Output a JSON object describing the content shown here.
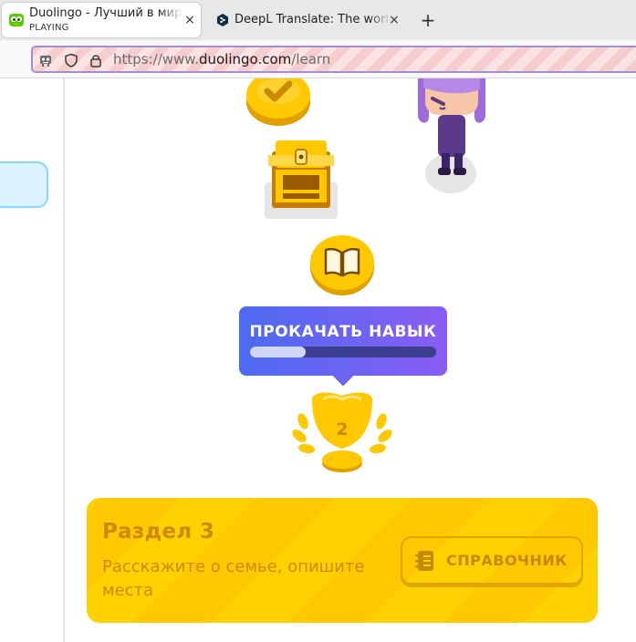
{
  "browser": {
    "tabs": [
      {
        "title": "Duolingo - Лучший в мире способ",
        "subtitle": "PLAYING",
        "active": true,
        "close_label": "×"
      },
      {
        "title": "DeepL Translate: The world",
        "active": false,
        "close_label": "×"
      }
    ],
    "new_tab_label": "+",
    "url": {
      "prefix": "https://www.",
      "host": "duolingo.com",
      "path": "/learn"
    }
  },
  "path": {
    "skill_tooltip": {
      "label": "ПРОКАЧАТЬ НАВЫК",
      "progress": 0.3
    },
    "trophy_level": "2"
  },
  "unit": {
    "title": "Раздел 3",
    "description": "Расскажите о семье, опишите места",
    "guide_label": "СПРАВОЧНИК"
  },
  "colors": {
    "accent_gold": "#ffc800",
    "tooltip_start": "#4b6bf0",
    "tooltip_end": "#8a5df4",
    "unit_text": "#cc8a00"
  }
}
